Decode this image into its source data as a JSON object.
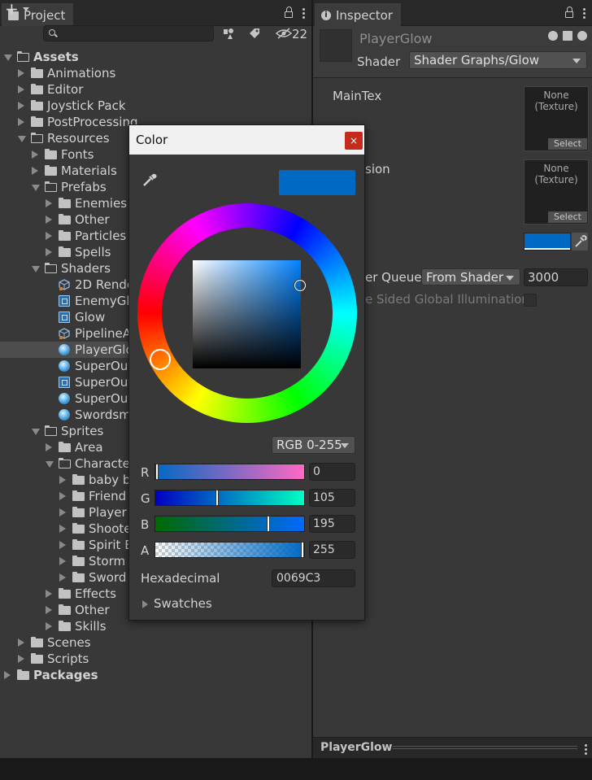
{
  "project": {
    "tab_label": "Project",
    "hidden_count": "22",
    "tree": [
      {
        "label": "Assets",
        "depth": 0,
        "state": "open",
        "icon": "folder",
        "bold": true
      },
      {
        "label": "Animations",
        "depth": 1,
        "state": "closed",
        "icon": "folder"
      },
      {
        "label": "Editor",
        "depth": 1,
        "state": "closed",
        "icon": "folder"
      },
      {
        "label": "Joystick Pack",
        "depth": 1,
        "state": "closed",
        "icon": "folder"
      },
      {
        "label": "PostProcessing",
        "depth": 1,
        "state": "closed",
        "icon": "folder"
      },
      {
        "label": "Resources",
        "depth": 1,
        "state": "open",
        "icon": "folder"
      },
      {
        "label": "Fonts",
        "depth": 2,
        "state": "closed",
        "icon": "folder"
      },
      {
        "label": "Materials",
        "depth": 2,
        "state": "closed",
        "icon": "folder"
      },
      {
        "label": "Prefabs",
        "depth": 2,
        "state": "open",
        "icon": "folder"
      },
      {
        "label": "Enemies",
        "depth": 3,
        "state": "closed",
        "icon": "folder"
      },
      {
        "label": "Other",
        "depth": 3,
        "state": "closed",
        "icon": "folder"
      },
      {
        "label": "Particles",
        "depth": 3,
        "state": "closed",
        "icon": "folder"
      },
      {
        "label": "Spells",
        "depth": 3,
        "state": "closed",
        "icon": "folder"
      },
      {
        "label": "Shaders",
        "depth": 2,
        "state": "open",
        "icon": "folder"
      },
      {
        "label": "2D Rende",
        "depth": 3,
        "state": "none",
        "icon": "shadergraph"
      },
      {
        "label": "EnemyGl",
        "depth": 3,
        "state": "none",
        "icon": "shader"
      },
      {
        "label": "Glow",
        "depth": 3,
        "state": "none",
        "icon": "shader"
      },
      {
        "label": "PipelineA",
        "depth": 3,
        "state": "none",
        "icon": "shadergraph"
      },
      {
        "label": "PlayerGlo",
        "depth": 3,
        "state": "none",
        "icon": "material",
        "selected": true
      },
      {
        "label": "SuperOut",
        "depth": 3,
        "state": "none",
        "icon": "material"
      },
      {
        "label": "SuperOut",
        "depth": 3,
        "state": "none",
        "icon": "shader"
      },
      {
        "label": "SuperOut",
        "depth": 3,
        "state": "none",
        "icon": "material"
      },
      {
        "label": "Swordsm",
        "depth": 3,
        "state": "none",
        "icon": "material"
      },
      {
        "label": "Sprites",
        "depth": 2,
        "state": "open",
        "icon": "folder"
      },
      {
        "label": "Area",
        "depth": 3,
        "state": "closed",
        "icon": "folder"
      },
      {
        "label": "Characte",
        "depth": 3,
        "state": "open",
        "icon": "folder"
      },
      {
        "label": "baby b",
        "depth": 4,
        "state": "closed",
        "icon": "folder"
      },
      {
        "label": "Friend",
        "depth": 4,
        "state": "closed",
        "icon": "folder"
      },
      {
        "label": "Player",
        "depth": 4,
        "state": "closed",
        "icon": "folder"
      },
      {
        "label": "Shoote",
        "depth": 4,
        "state": "closed",
        "icon": "folder"
      },
      {
        "label": "Spirit E",
        "depth": 4,
        "state": "closed",
        "icon": "folder"
      },
      {
        "label": "Storm",
        "depth": 4,
        "state": "closed",
        "icon": "folder"
      },
      {
        "label": "Sword",
        "depth": 4,
        "state": "closed",
        "icon": "folder"
      },
      {
        "label": "Effects",
        "depth": 3,
        "state": "closed",
        "icon": "folder"
      },
      {
        "label": "Other",
        "depth": 3,
        "state": "closed",
        "icon": "folder"
      },
      {
        "label": "Skills",
        "depth": 3,
        "state": "closed",
        "icon": "folder"
      },
      {
        "label": "Scenes",
        "depth": 1,
        "state": "closed",
        "icon": "folder"
      },
      {
        "label": "Scripts",
        "depth": 1,
        "state": "closed",
        "icon": "folder"
      },
      {
        "label": "Packages",
        "depth": 0,
        "state": "closed",
        "icon": "folder",
        "bold": true
      }
    ]
  },
  "inspector": {
    "tab_label": "Inspector",
    "material_name": "PlayerGlow",
    "shader_label": "Shader",
    "shader_value": "Shader Graphs/Glow",
    "maintex_label": "MainTex",
    "tex1_none": "None",
    "tex1_type": "(Texture)",
    "tex1_select": "Select",
    "emission_label": "sion",
    "tex2_none": "None",
    "tex2_type": "(Texture)",
    "tex2_select": "Select",
    "render_queue_label": "er Queue",
    "render_queue_mode": "From Shader",
    "render_queue_value": "3000",
    "double_sided_label": "e Sided Global Illumination",
    "bottom_name": "PlayerGlow",
    "swatch_color": "#0069C3"
  },
  "color_picker": {
    "title": "Color",
    "close": "×",
    "mode": "RGB 0-255",
    "r_label": "R",
    "r_value": "0",
    "g_label": "G",
    "g_value": "105",
    "b_label": "B",
    "b_value": "195",
    "a_label": "A",
    "a_value": "255",
    "hex_label": "Hexadecimal",
    "hex_value": "0069C3",
    "swatches_label": "Swatches",
    "current_color": "#0069C3",
    "r": 0,
    "g": 105,
    "b": 195,
    "a": 255
  }
}
